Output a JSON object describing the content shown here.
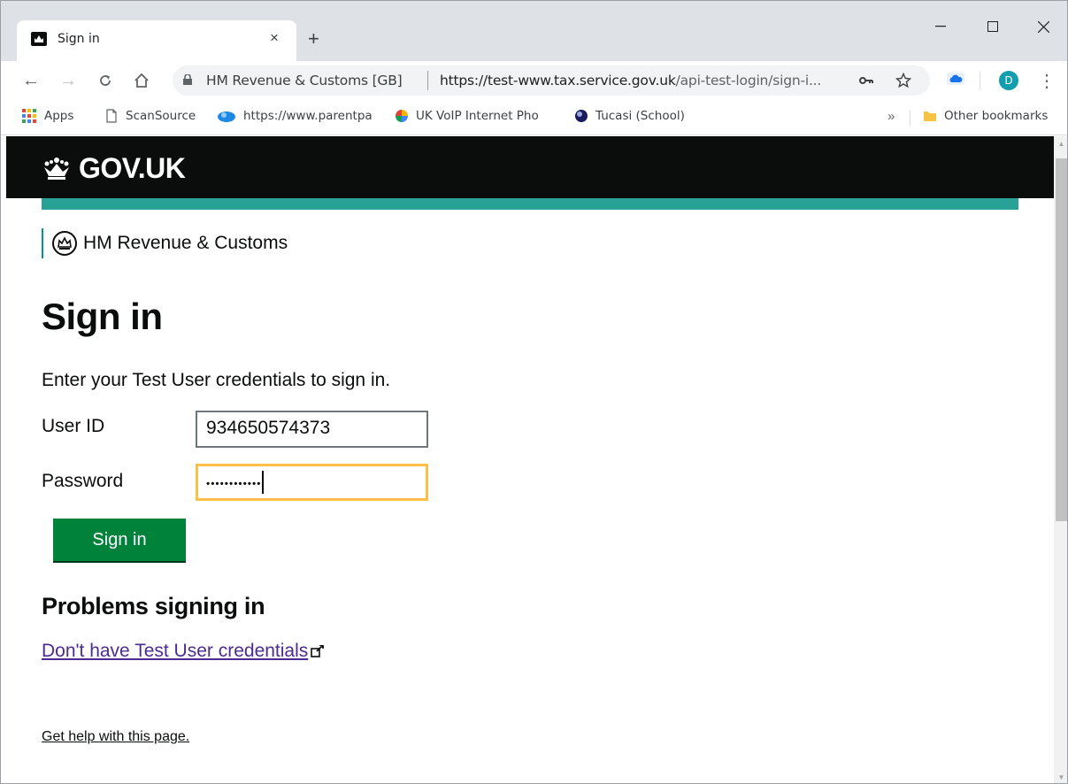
{
  "browser": {
    "tab": {
      "title": "Sign in",
      "close_glyph": "×",
      "favicon": "crown-icon"
    },
    "new_tab_glyph": "+",
    "window_controls": {
      "minimize": "—",
      "maximize": "☐",
      "close": "✕"
    },
    "nav": {
      "back": "←",
      "forward": "→",
      "reload": "C",
      "home": "⌂"
    },
    "omnibox": {
      "site_identity": "HM Revenue & Customs [GB]",
      "url_host": "https://test-www.tax.service.gov.uk",
      "url_path": "/api-test-login/sign-i..."
    },
    "profile_initial": "D",
    "menu_glyph": "⋮",
    "bookmarks": [
      {
        "label": "Apps",
        "icon": "apps-grid-icon"
      },
      {
        "label": "ScanSource",
        "icon": "page-icon"
      },
      {
        "label": "https://www.parentpa",
        "icon": "blue-cloud-icon"
      },
      {
        "label": "UK VoIP Internet Pho",
        "icon": "pinwheel-icon"
      },
      {
        "label": "Tucasi (School)",
        "icon": "globe-icon"
      }
    ],
    "bookmarks_overflow": "»",
    "other_bookmarks": "Other bookmarks"
  },
  "page": {
    "header_logo": "GOV.UK",
    "department": "HM Revenue & Customs",
    "title": "Sign in",
    "intro": "Enter your Test User credentials to sign in.",
    "form": {
      "user_id_label": "User ID",
      "user_id_value": "934650574373",
      "password_label": "Password",
      "password_value": "••••••••••••",
      "submit_label": "Sign in"
    },
    "problems_heading": "Problems signing in",
    "credentials_link": "Don't have Test User credentials",
    "help_link": "Get help with this page."
  },
  "colors": {
    "govuk_black": "#0b0c0c",
    "hmrc_teal": "#28a197",
    "button_green": "#00823b",
    "focus_yellow": "#ffbf47",
    "link_visited": "#4c2c92"
  }
}
